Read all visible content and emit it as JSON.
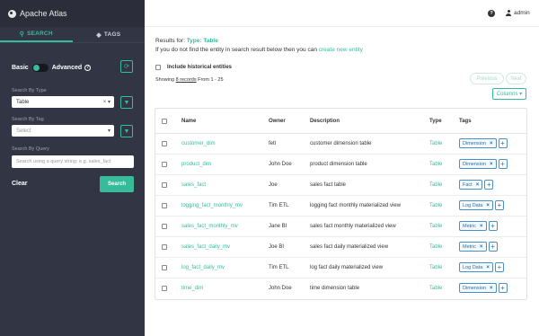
{
  "app": {
    "title": "Apache Atlas"
  },
  "sidebar": {
    "tabs": [
      {
        "label": "SEARCH",
        "icon": "search-icon"
      },
      {
        "label": "TAGS",
        "icon": "tag-icon"
      }
    ],
    "mode": {
      "basic": "Basic",
      "advanced": "Advanced",
      "help": "?"
    },
    "search_by_type": {
      "label": "Search By Type",
      "value": "Table",
      "clear": "×",
      "chevron": "▾"
    },
    "search_by_tag": {
      "label": "Search By Tag",
      "placeholder": "Select",
      "chevron": "▾"
    },
    "search_by_query": {
      "label": "Search By Query",
      "placeholder": "Search using a query string: e.g. sales_fact"
    },
    "clear_label": "Clear",
    "search_label": "Search"
  },
  "header": {
    "help": "?",
    "user": "admin"
  },
  "results": {
    "prefix": "Results for:",
    "type_text": "Type: Table",
    "not_found_text": "If you do not find the entity in search result below then you can",
    "create_link": "create new entity",
    "historical_label": "Include historical entities",
    "showing_prefix": "Showing",
    "records_link": "8 records",
    "showing_suffix": "From 1 - 25",
    "previous": "Previous",
    "next": "Next",
    "columns_label": "Columns ▾"
  },
  "table": {
    "headers": {
      "name": "Name",
      "owner": "Owner",
      "description": "Description",
      "type": "Type",
      "tags": "Tags"
    },
    "rows": [
      {
        "name": "customer_dim",
        "owner": "fetl",
        "description": "customer dimension table",
        "type": "Table",
        "tag": "Dimension"
      },
      {
        "name": "product_dim",
        "owner": "John Doe",
        "description": "product dimension table",
        "type": "Table",
        "tag": "Dimension"
      },
      {
        "name": "sales_fact",
        "owner": "Joe",
        "description": "sales fact table",
        "type": "Table",
        "tag": "Fact"
      },
      {
        "name": "logging_fact_monthly_mv",
        "owner": "Tim ETL",
        "description": "logging fact monthly materialized view",
        "type": "Table",
        "tag": "Log Data"
      },
      {
        "name": "sales_fact_monthly_mv",
        "owner": "Jane BI",
        "description": "sales fact monthly materialized view",
        "type": "Table",
        "tag": "Metric"
      },
      {
        "name": "sales_fact_daily_mv",
        "owner": "Joe BI",
        "description": "sales fact daily materialized view",
        "type": "Table",
        "tag": "Metric"
      },
      {
        "name": "log_fact_daily_mv",
        "owner": "Tim ETL",
        "description": "log fact daily materialized view",
        "type": "Table",
        "tag": "Log Data"
      },
      {
        "name": "time_dim",
        "owner": "John Doe",
        "description": "time dimension table",
        "type": "Table",
        "tag": "Dimension"
      }
    ]
  },
  "colors": {
    "accent": "#37bb9b",
    "sidebar_bg": "#323544",
    "tag_border": "#4a90c4"
  }
}
